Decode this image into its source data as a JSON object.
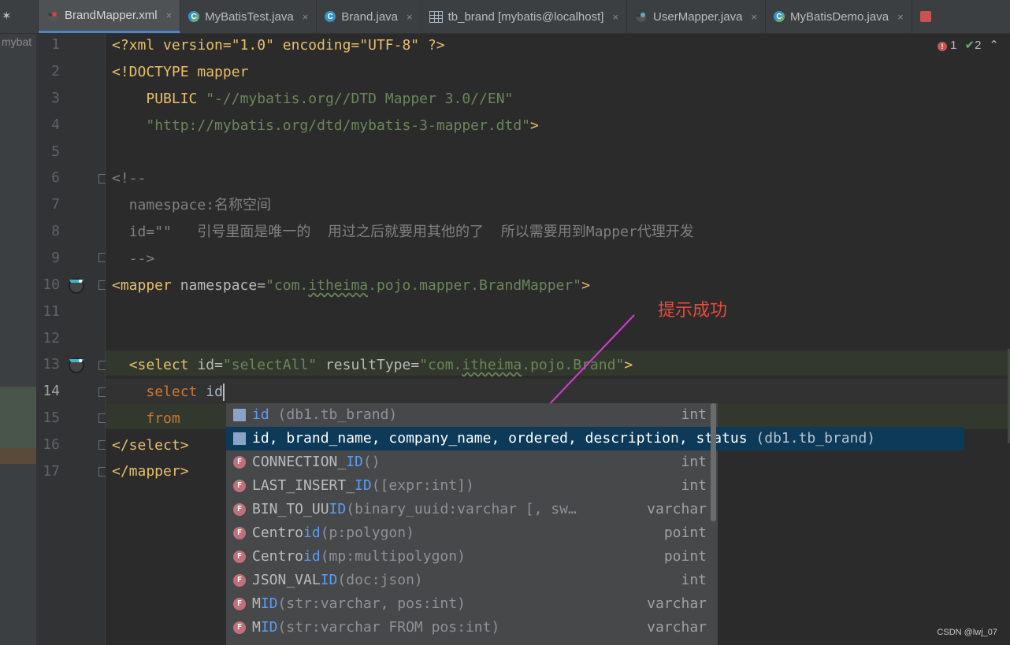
{
  "tabs": [
    {
      "label": "BrandMapper.xml",
      "icon": "mybatis-bird-icon",
      "active": true
    },
    {
      "label": "MyBatisTest.java",
      "icon": "java-class-icon",
      "active": false
    },
    {
      "label": "Brand.java",
      "icon": "java-class-icon",
      "active": false
    },
    {
      "label": "tb_brand [mybatis@localhost]",
      "icon": "table-icon",
      "active": false
    },
    {
      "label": "UserMapper.java",
      "icon": "mybatis-bird-icon",
      "active": false
    },
    {
      "label": "MyBatisDemo.java",
      "icon": "java-class-icon",
      "active": false
    }
  ],
  "tab_close": "×",
  "project_strip_label": "mybat",
  "inspections": {
    "errors": "1",
    "warnings": "2"
  },
  "line_numbers": [
    "1",
    "2",
    "3",
    "4",
    "5",
    "6",
    "7",
    "8",
    "9",
    "10",
    "11",
    "12",
    "13",
    "14",
    "15",
    "16",
    "17"
  ],
  "code": {
    "l1": "<?xml version=\"1.0\" encoding=\"UTF-8\" ?>",
    "l2_a": "<!DOCTYPE mapper",
    "l3_a": "PUBLIC",
    "l3_b": "\"-//mybatis.org//DTD Mapper 3.0//EN\"",
    "l4_a": "\"http://mybatis.org/dtd/mybatis-3-mapper.dtd\"",
    "l4_b": ">",
    "l6": "<!--",
    "l7": "namespace:名称空间",
    "l8": "id=\"\"   引号里面是唯一的  用过之后就要用其他的了  所以需要用到Mapper代理开发",
    "l9": "-->",
    "l10_tag": "<mapper",
    "l10_attr": "namespace=",
    "l10_val_a": "\"com.",
    "l10_val_b": "itheima",
    "l10_val_c": ".pojo.mapper.BrandMapper\"",
    "l10_end": ">",
    "l13_tag": "<select",
    "l13_attr1": "id=",
    "l13_val1": "\"selectAll\"",
    "l13_attr2": "resultType=",
    "l13_val2_a": "\"com.",
    "l13_val2_b": "itheima",
    "l13_val2_c": ".pojo.Brand\"",
    "l13_end": ">",
    "l14_kw": "select",
    "l14_id": "id",
    "l15_kw": "from",
    "l16": "</select>",
    "l17": "</mapper>"
  },
  "annotation": "提示成功",
  "completion": [
    {
      "pre": "",
      "match": "id",
      "post": "",
      "hint": " (db1.tb_brand)",
      "type": "int",
      "icon": "column-key-icon"
    },
    {
      "pre": "",
      "match": "id",
      "post": ", brand_name, company_name, ordered, description, status",
      "hint": " (db1.tb_brand)",
      "type": "",
      "icon": "column-list-icon",
      "selected": true
    },
    {
      "pre": "CONNECTION_",
      "match": "ID",
      "post": "",
      "hint": "()",
      "type": "int",
      "icon": "function-icon"
    },
    {
      "pre": "LAST_INSERT_",
      "match": "ID",
      "post": "",
      "hint": "([expr:int])",
      "type": "int",
      "icon": "function-icon"
    },
    {
      "pre": "BIN_TO_UU",
      "match": "ID",
      "post": "",
      "hint": "(binary_uuid:varchar [, sw…",
      "type": "varchar",
      "icon": "function-icon"
    },
    {
      "pre": "Centro",
      "match": "id",
      "post": "",
      "hint": "(p:polygon)",
      "type": "point",
      "icon": "function-icon"
    },
    {
      "pre": "Centro",
      "match": "id",
      "post": "",
      "hint": "(mp:multipolygon)",
      "type": "point",
      "icon": "function-icon"
    },
    {
      "pre": "JSON_VAL",
      "match": "ID",
      "post": "",
      "hint": "(doc:json)",
      "type": "int",
      "icon": "function-icon"
    },
    {
      "pre": "M",
      "match": "ID",
      "post": "",
      "hint": "(str:varchar, pos:int)",
      "type": "varchar",
      "icon": "function-icon"
    },
    {
      "pre": "M",
      "match": "ID",
      "post": "",
      "hint": "(str:varchar FROM pos:int)",
      "type": "varchar",
      "icon": "function-icon"
    }
  ],
  "function_icon_letter": "F",
  "watermark": "CSDN @lwj_07",
  "colors": {
    "accent": "#4a88c7",
    "selection": "#0d3a58",
    "annotation": "#e74c3c",
    "arrow": "#d63bd6"
  }
}
